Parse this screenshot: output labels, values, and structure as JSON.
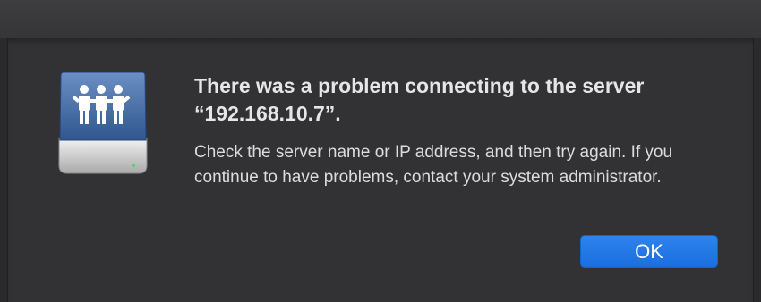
{
  "dialog": {
    "icon": "network-server-drive-icon",
    "title": "There was a problem connecting to the server “192.168.10.7”.",
    "message": "Check the server name or IP address, and then try again. If you continue to have problems, contact your system administrator.",
    "ok_label": "OK"
  },
  "colors": {
    "accent": "#1f74e6",
    "background": "#323234",
    "title_text": "#e6e6e6"
  }
}
